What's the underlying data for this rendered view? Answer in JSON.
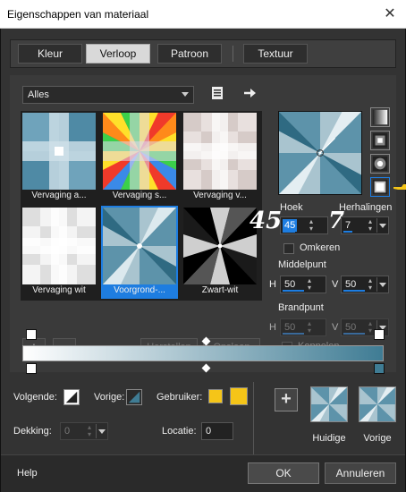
{
  "window": {
    "title": "Eigenschappen van materiaal",
    "close_glyph": "✕"
  },
  "tabs": [
    {
      "label": "Kleur",
      "active": false
    },
    {
      "label": "Verloop",
      "active": true
    },
    {
      "label": "Patroon",
      "active": false
    },
    {
      "label": "Textuur",
      "active": false
    }
  ],
  "gradient_picker": {
    "category": "Alles",
    "swatches": [
      {
        "label": "Vervaging a...",
        "selected": false
      },
      {
        "label": "Vervaging s...",
        "selected": false
      },
      {
        "label": "Vervaging v...",
        "selected": false
      },
      {
        "label": "Vervaging wit",
        "selected": false
      },
      {
        "label": "Voorgrond-...",
        "selected": true
      },
      {
        "label": "Zwart-wit",
        "selected": false
      }
    ],
    "add_label": "+",
    "remove_label": "-",
    "restore_label": "Herstellen",
    "save_label": "Opslaan"
  },
  "settings": {
    "angle_label": "Hoek",
    "angle_value": "45",
    "repeats_label": "Herhalingen",
    "repeats_value": "7",
    "annotation_angle": "45",
    "annotation_repeats": "7",
    "invert_label": "Omkeren",
    "center_label": "Middelpunt",
    "center_h_label": "H",
    "center_h_value": "50",
    "center_v_label": "V",
    "center_v_value": "50",
    "focal_label": "Brandpunt",
    "focal_h_label": "H",
    "focal_h_value": "50",
    "focal_v_label": "V",
    "focal_v_value": "50",
    "link_label": "Koppelen"
  },
  "editor": {
    "next_label": "Volgende:",
    "prev_label": "Vorige:",
    "user_label": "Gebruiker:",
    "opacity_label": "Dekking:",
    "opacity_value": "0",
    "location_label": "Locatie:",
    "location_value": "0",
    "add_glyph": "+",
    "current_label": "Huidige",
    "previous_label": "Vorige",
    "user_color": "#f5c518",
    "accent_color": "#1e7de0",
    "gradient_colors": [
      "#ffffff",
      "#a9c4cf",
      "#3f7c94"
    ]
  },
  "footer": {
    "help_label": "Help",
    "ok_label": "OK",
    "cancel_label": "Annuleren"
  }
}
